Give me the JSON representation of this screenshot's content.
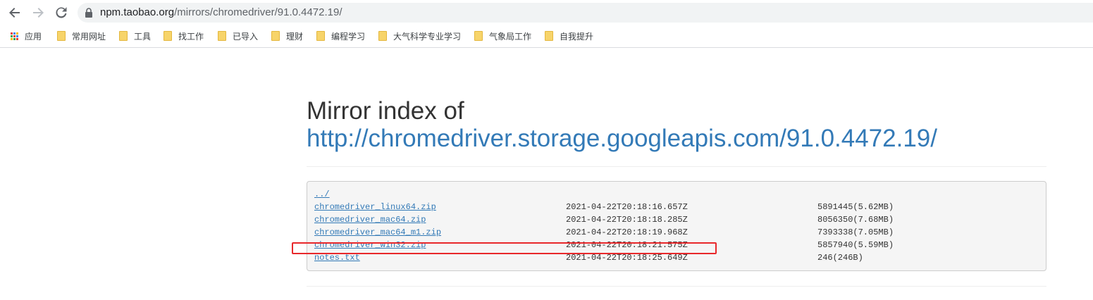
{
  "browser": {
    "url_host": "npm.taobao.org",
    "url_path": "/mirrors/chromedriver/91.0.4472.19/",
    "bookmarks": [
      {
        "label": "应用",
        "icon": "apps-icon"
      },
      {
        "label": "常用网址",
        "icon": "folder-icon"
      },
      {
        "label": "工具",
        "icon": "folder-icon"
      },
      {
        "label": "找工作",
        "icon": "folder-icon"
      },
      {
        "label": "已导入",
        "icon": "folder-icon"
      },
      {
        "label": "理财",
        "icon": "folder-icon"
      },
      {
        "label": "编程学习",
        "icon": "folder-icon"
      },
      {
        "label": "大气科学专业学习",
        "icon": "folder-icon"
      },
      {
        "label": "气象局工作",
        "icon": "folder-icon"
      },
      {
        "label": "自我提升",
        "icon": "folder-icon"
      }
    ]
  },
  "page": {
    "title_prefix": "Mirror index of",
    "title_link": "http://chromedriver.storage.googleapis.com/91.0.4472.19/",
    "parent_link": "../",
    "files": [
      {
        "name": "chromedriver_linux64.zip",
        "date": "2021-04-22T20:18:16.657Z",
        "size": "5891445(5.62MB)"
      },
      {
        "name": "chromedriver_mac64.zip",
        "date": "2021-04-22T20:18:18.285Z",
        "size": "8056350(7.68MB)"
      },
      {
        "name": "chromedriver_mac64_m1.zip",
        "date": "2021-04-22T20:18:19.968Z",
        "size": "7393338(7.05MB)"
      },
      {
        "name": "chromedriver_win32.zip",
        "date": "2021-04-22T20:18:21.575Z",
        "size": "5857940(5.59MB)"
      },
      {
        "name": "notes.txt",
        "date": "2021-04-22T20:18:25.649Z",
        "size": "246(246B)"
      }
    ]
  },
  "colors": {
    "link": "#337ab7",
    "highlight": "#e8282b",
    "folder": "#f7d46a"
  }
}
